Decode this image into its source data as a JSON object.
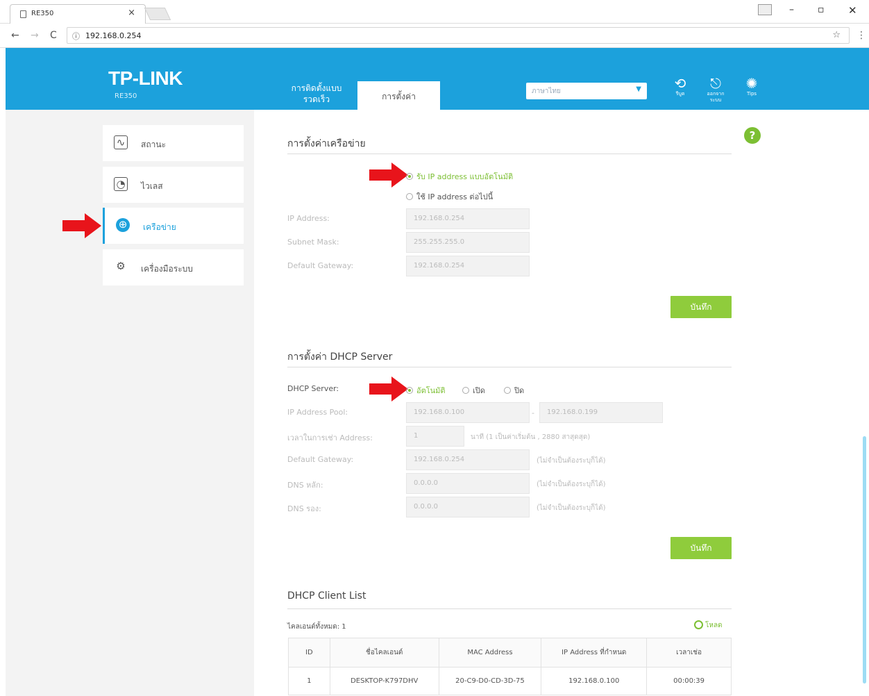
{
  "browser": {
    "tab_title": "RE350",
    "tab_close": "×",
    "url": "192.168.0.254",
    "win_minimize": "–",
    "win_maximize": "▫",
    "win_close": "✕",
    "back": "←",
    "forward": "→",
    "reload": "C",
    "info": "ⓘ",
    "star": "☆",
    "menu": "⋮"
  },
  "header": {
    "logo": "TP-LINK",
    "model": "RE350",
    "tabs": {
      "quick_setup": "การติดตั้งแบบรวดเร็ว",
      "settings": "การตั้งค่า"
    },
    "language_select": "ภาษาไทย",
    "icons": {
      "reboot": "รีบูต",
      "logout": "ออกจากระบบ",
      "tips": "Tips"
    }
  },
  "sidebar": {
    "items": [
      {
        "label": "สถานะ",
        "icon": "status-icon"
      },
      {
        "label": "ไวเลส",
        "icon": "wireless-icon"
      },
      {
        "label": "เครือข่าย",
        "icon": "network-globe-icon"
      },
      {
        "label": "เครื่องมือระบบ",
        "icon": "gear-icon"
      }
    ]
  },
  "network": {
    "title": "การตั้งค่าเครือข่าย",
    "radio_auto": "รับ IP address แบบอัตโนมัติ",
    "radio_static": "ใช้ IP address ต่อไปนี้",
    "ip_label": "IP Address:",
    "ip_value": "192.168.0.254",
    "mask_label": "Subnet Mask:",
    "mask_value": "255.255.255.0",
    "gw_label": "Default Gateway:",
    "gw_value": "192.168.0.254",
    "save": "บันทึก"
  },
  "dhcp": {
    "title": "การตั้งค่า DHCP Server",
    "server_label": "DHCP Server:",
    "opt_auto": "อัตโนมัติ",
    "opt_on": "เปิด",
    "opt_off": "ปิด",
    "pool_label": "IP Address Pool:",
    "pool_start": "192.168.0.100",
    "pool_dash": "-",
    "pool_end": "192.168.0.199",
    "lease_label": "เวลาในการเช่า Address:",
    "lease_value": "1",
    "lease_hint": "นาที (1 เป็นค่าเริ่มต้น , 2880 สาสุดสุด)",
    "gw_label": "Default Gateway:",
    "gw_value": "192.168.0.254",
    "gw_hint": "(ไม่จำเป็นต้องระบุก็ได้)",
    "dns1_label": "DNS หลัก:",
    "dns1_value": "0.0.0.0",
    "dns1_hint": "(ไม่จำเป็นต้องระบุก็ได้)",
    "dns2_label": "DNS รอง:",
    "dns2_value": "0.0.0.0",
    "dns2_hint": "(ไม่จำเป็นต้องระบุก็ได้)",
    "save": "บันทึก"
  },
  "clients": {
    "title": "DHCP Client List",
    "count_text": "ไคลเอนต์ทั้งหมด: 1",
    "refresh": "โหลด",
    "columns": [
      "ID",
      "ชื่อไคลเอนต์",
      "MAC Address",
      "IP Address ที่กำหนด",
      "เวลาเช่อ"
    ],
    "rows": [
      [
        "1",
        "DESKTOP-K797DHV",
        "20-C9-D0-CD-3D-75",
        "192.168.0.100",
        "00:00:39"
      ]
    ]
  },
  "colors": {
    "brand_blue": "#1ca1dc",
    "accent_green": "#8fcc3c",
    "arrow_red": "#e8141b"
  }
}
